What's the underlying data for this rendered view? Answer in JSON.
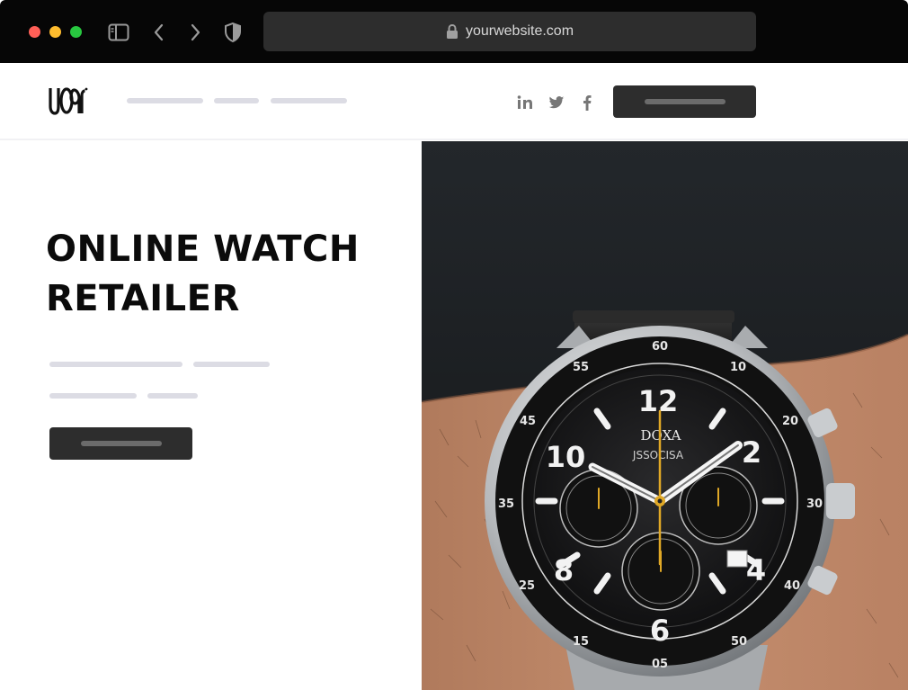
{
  "browser": {
    "url": "yourwebsite.com",
    "icons": [
      "close-dot",
      "minimize-dot",
      "maximize-dot",
      "sidebar-icon",
      "back-icon",
      "forward-icon",
      "shield-icon",
      "lock-icon"
    ]
  },
  "header": {
    "logo_text": "LOGO",
    "social": [
      {
        "name": "linkedin-icon",
        "glyph": "in"
      },
      {
        "name": "twitter-icon"
      },
      {
        "name": "facebook-icon",
        "glyph": "f"
      }
    ]
  },
  "hero": {
    "title_line1": "ONLINE WATCH",
    "title_line2": "RETAILER",
    "watch_brand": "DOXA",
    "watch_subdial_text": "JSSOCISA",
    "watch_numbers": [
      "12",
      "2",
      "4",
      "6",
      "8",
      "10"
    ]
  },
  "colors": {
    "browser_bar": "#060606",
    "url_bar": "#2d2d2d",
    "placeholder": "#dcdce4",
    "button": "#2d2d2d",
    "text": "#0b0b0b"
  }
}
